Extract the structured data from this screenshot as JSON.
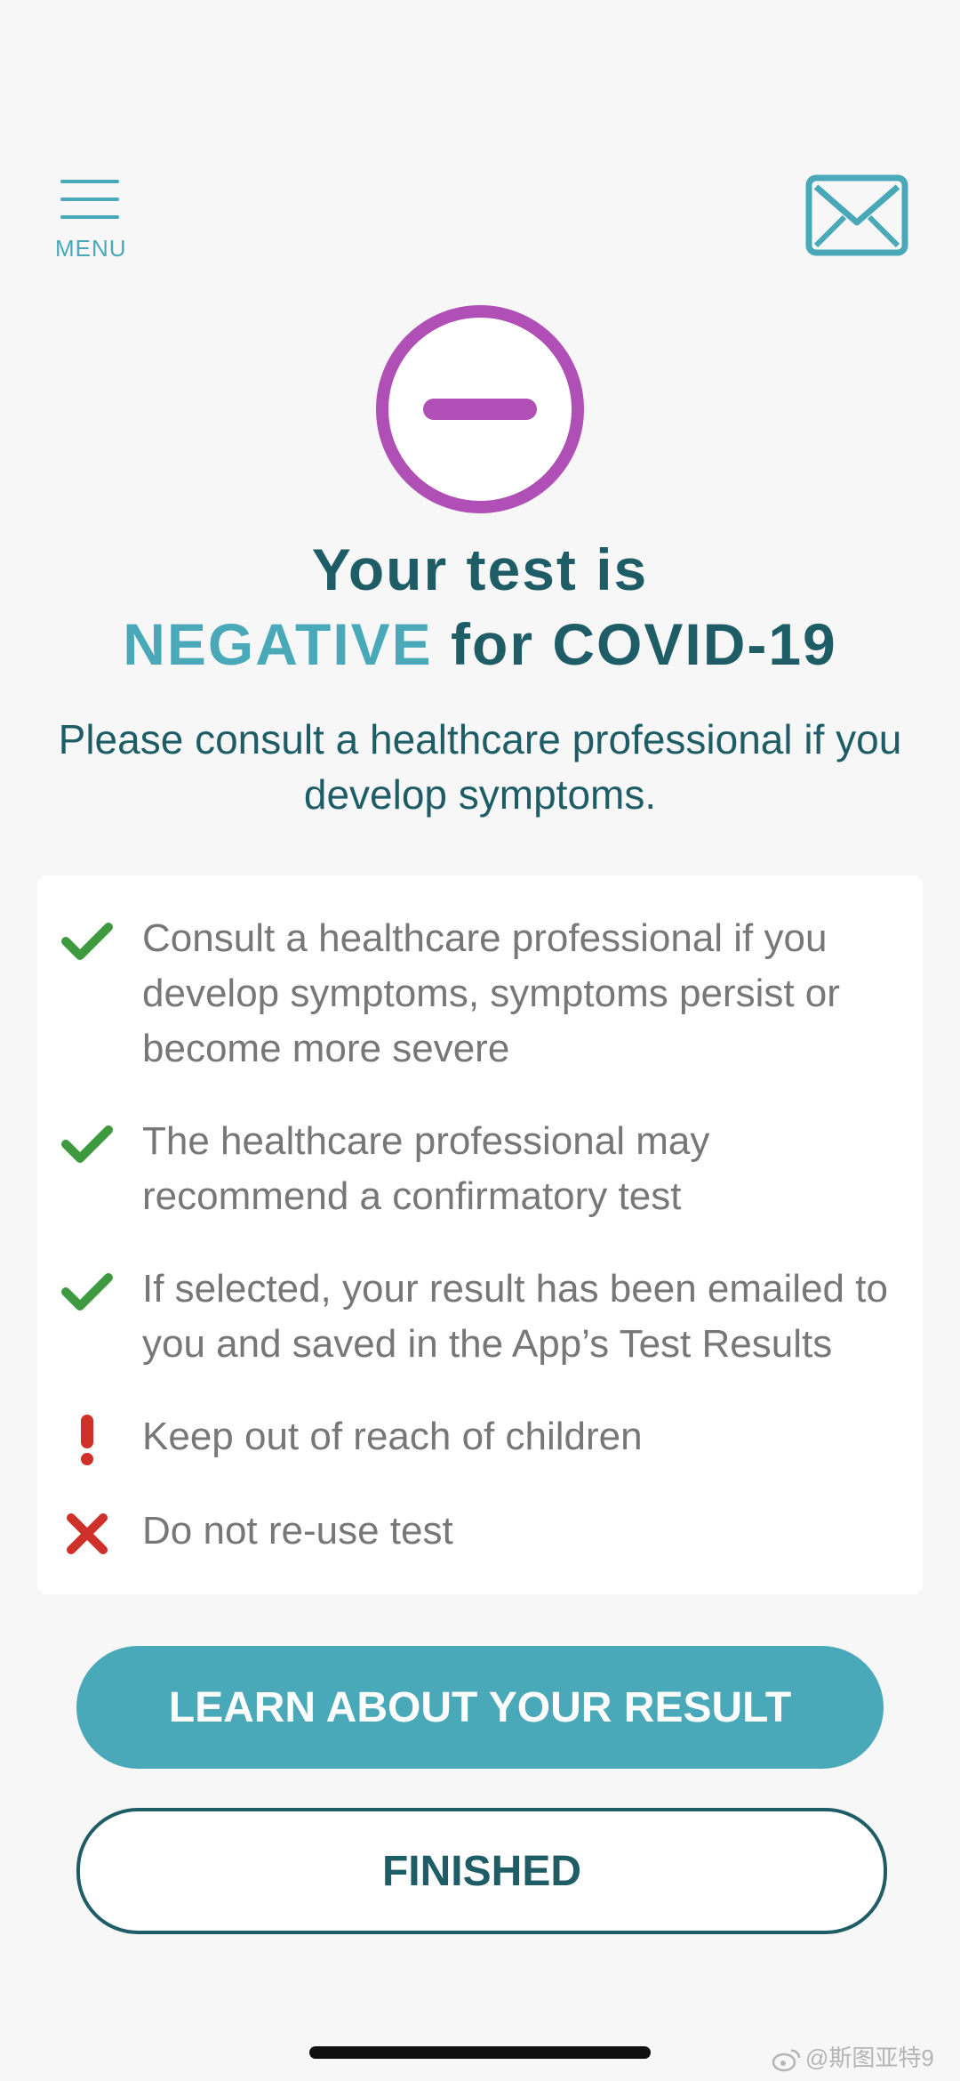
{
  "header": {
    "menu_label": "MENU",
    "menu_icon": "hamburger-icon",
    "mail_icon": "envelope-icon"
  },
  "result": {
    "icon": "minus-circle-icon",
    "headline_line1": "Your test is",
    "result_word": "NEGATIVE",
    "headline_rest": " for COVID-19",
    "subtitle": "Please consult a healthcare professional if you develop symptoms."
  },
  "guidance": {
    "items": [
      {
        "icon": "check-icon",
        "text": "Consult a healthcare professional if you develop symptoms, symptoms persist or become more severe"
      },
      {
        "icon": "check-icon",
        "text": "The healthcare professional may recommend a confirmatory test"
      },
      {
        "icon": "check-icon",
        "text": "If selected, your result has been emailed to you and saved in the App’s Test Results"
      },
      {
        "icon": "exclamation-icon",
        "text": "Keep out of reach of children"
      },
      {
        "icon": "x-icon",
        "text": "Do not re-use test"
      }
    ]
  },
  "buttons": {
    "learn_label": "LEARN ABOUT YOUR RESULT",
    "finished_label": "FINISHED"
  },
  "watermark": {
    "text": "@斯图亚特9"
  },
  "colors": {
    "teal": "#4aa9b8",
    "dark_teal": "#1f5d66",
    "purple": "#b04fb5",
    "green_check": "#3f9a3f",
    "red_alert": "#d0302a"
  }
}
